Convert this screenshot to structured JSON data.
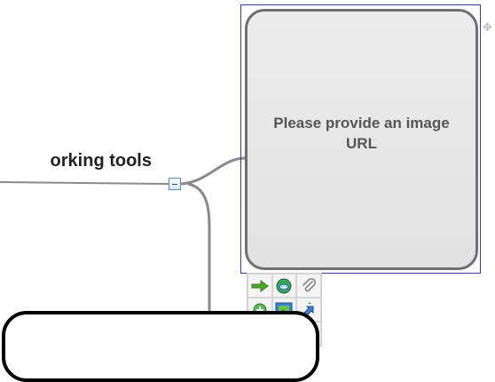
{
  "node": {
    "label": "orking tools"
  },
  "image_node": {
    "placeholder_text": "Please provide an image URL"
  },
  "toolbar": {
    "tools": [
      {
        "icon": "arrow-right-icon"
      },
      {
        "icon": "link-globe-icon"
      },
      {
        "icon": "paperclip-icon"
      },
      {
        "icon": "add-node-icon"
      },
      {
        "icon": "image-icon"
      },
      {
        "icon": "relation-arrows-icon"
      }
    ]
  },
  "colors": {
    "selection_border": "#3b3ba8",
    "card_border": "#707070",
    "card_fill": "#e6e6e6",
    "connector": "#8a8a8a"
  }
}
